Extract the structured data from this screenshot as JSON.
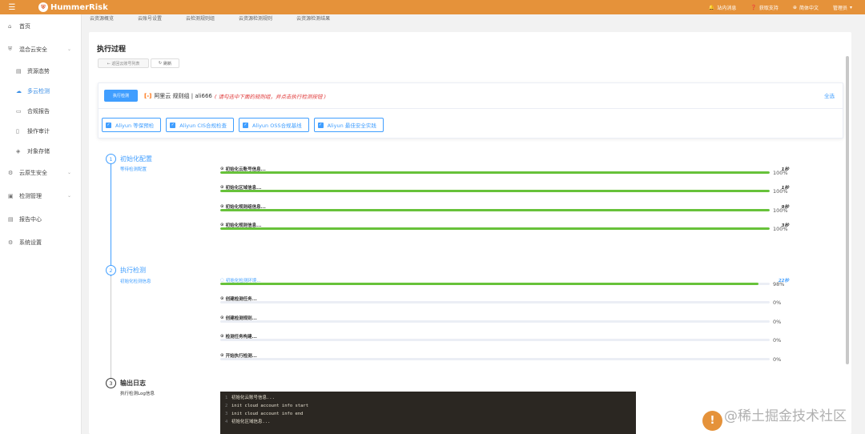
{
  "topbar": {
    "brand": "HummerRisk",
    "messages": "站内消息",
    "support": "获取支持",
    "language": "简体中文",
    "user": "管理员"
  },
  "subnav": [
    "云资源概览",
    "云账号设置",
    "云检测规则组",
    "云资源检测规则",
    "云资源检测结果"
  ],
  "sidebar": {
    "items": [
      {
        "label": "首页",
        "icon": "home-icon"
      },
      {
        "label": "混合云安全",
        "icon": "shield-icon",
        "expandable": true
      },
      {
        "label": "资源态势",
        "icon": "chart-icon",
        "sub": true
      },
      {
        "label": "多云检测",
        "icon": "cloud-icon",
        "sub": true,
        "active": true
      },
      {
        "label": "合规报告",
        "icon": "doc-icon",
        "sub": true
      },
      {
        "label": "操作审计",
        "icon": "audit-icon",
        "sub": true
      },
      {
        "label": "对象存储",
        "icon": "storage-icon",
        "sub": true
      },
      {
        "label": "云原生安全",
        "icon": "gear-icon",
        "expandable": true
      },
      {
        "label": "检测管理",
        "icon": "monitor-icon",
        "expandable": true
      },
      {
        "label": "报告中心",
        "icon": "report-icon"
      },
      {
        "label": "系统设置",
        "icon": "settings-icon"
      }
    ]
  },
  "main": {
    "title": "执行过程",
    "back_label": "← 返回云账号列表",
    "refresh_label": "刷新"
  },
  "panel": {
    "run_label": "执行检测",
    "provider_icon": "aliyun-logo",
    "account_text": "阿里云 规则组 | ali666",
    "hint": "( 请勾选中下面的规则组，并点击执行检测按钮 )",
    "select_all": "全选",
    "groups": [
      "Aliyun 等保预检",
      "Aliyun CIS合规检查",
      "Aliyun OSS合规基线",
      "Aliyun 最佳安全实践"
    ]
  },
  "steps": [
    {
      "num": "1",
      "title": "初始化配置",
      "subtitle": "等待检测配置"
    },
    {
      "num": "2",
      "title": "执行检测",
      "subtitle": "初始化检测信息"
    },
    {
      "num": "3",
      "title": "输出日志",
      "subtitle": "执行检测Log信息"
    }
  ],
  "tasks": [
    {
      "label": "初始化云账号信息...",
      "time": "1秒",
      "progress": 100,
      "pct": "100%",
      "state": "done"
    },
    {
      "label": "初始化区域信息...",
      "time": "1秒",
      "progress": 100,
      "pct": "100%",
      "state": "done"
    },
    {
      "label": "初始化规则组信息...",
      "time": "9秒",
      "progress": 100,
      "pct": "100%",
      "state": "done"
    },
    {
      "label": "初始化规则信息...",
      "time": "3秒",
      "progress": 100,
      "pct": "100%",
      "state": "done"
    },
    {
      "label": "初始化检测环境...",
      "time": "22秒",
      "progress": 98,
      "pct": "98%",
      "state": "running"
    },
    {
      "label": "创建检测任务...",
      "time": "",
      "progress": 0,
      "pct": "0%",
      "state": "pending"
    },
    {
      "label": "创建检测规则...",
      "time": "",
      "progress": 0,
      "pct": "0%",
      "state": "pending"
    },
    {
      "label": "检测任务构建...",
      "time": "",
      "progress": 0,
      "pct": "0%",
      "state": "pending"
    },
    {
      "label": "开始执行检测...",
      "time": "",
      "progress": 0,
      "pct": "0%",
      "state": "pending"
    }
  ],
  "log": [
    {
      "n": "1",
      "text": "初始化云账号信息..."
    },
    {
      "n": "2",
      "text": "init cloud account info start"
    },
    {
      "n": "3",
      "text": "init cloud account info end"
    },
    {
      "n": "4",
      "text": "初始化区域信息..."
    }
  ],
  "feedback_label": "!",
  "watermark": "@稀土掘金技术社区",
  "colors": {
    "brand": "#e5923a",
    "primary": "#409eff",
    "success": "#67c23a",
    "hint": "#e03c3c"
  }
}
